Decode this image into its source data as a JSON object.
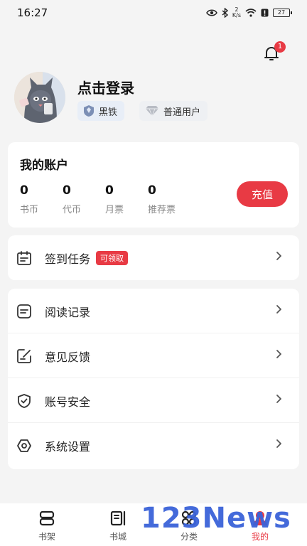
{
  "status_bar": {
    "time": "16:27",
    "net_speed_value": "2",
    "net_speed_unit": "K/s",
    "battery": "27"
  },
  "notifications": {
    "badge_count": "1"
  },
  "profile": {
    "login_text": "点击登录",
    "level_badge": "黑铁",
    "user_type": "普通用户"
  },
  "account": {
    "title": "我的账户",
    "stats": [
      {
        "value": "0",
        "label": "书币"
      },
      {
        "value": "0",
        "label": "代币"
      },
      {
        "value": "0",
        "label": "月票"
      },
      {
        "value": "0",
        "label": "推荐票"
      }
    ],
    "recharge_label": "充值"
  },
  "tasks": {
    "label": "签到任务",
    "badge": "可领取"
  },
  "menu": [
    {
      "label": "阅读记录",
      "icon": "reading-history-icon"
    },
    {
      "label": "意见反馈",
      "icon": "feedback-icon"
    },
    {
      "label": "账号安全",
      "icon": "shield-icon"
    },
    {
      "label": "系统设置",
      "icon": "settings-icon"
    }
  ],
  "bottom_nav": [
    {
      "label": "书架",
      "icon": "bookshelf-icon"
    },
    {
      "label": "书城",
      "icon": "bookstore-icon"
    },
    {
      "label": "分类",
      "icon": "category-icon"
    },
    {
      "label": "我的",
      "icon": "profile-icon",
      "active": true
    }
  ],
  "colors": {
    "accent": "#e83a44",
    "background": "#f4f4f4",
    "card": "#ffffff"
  },
  "watermark": "123News"
}
